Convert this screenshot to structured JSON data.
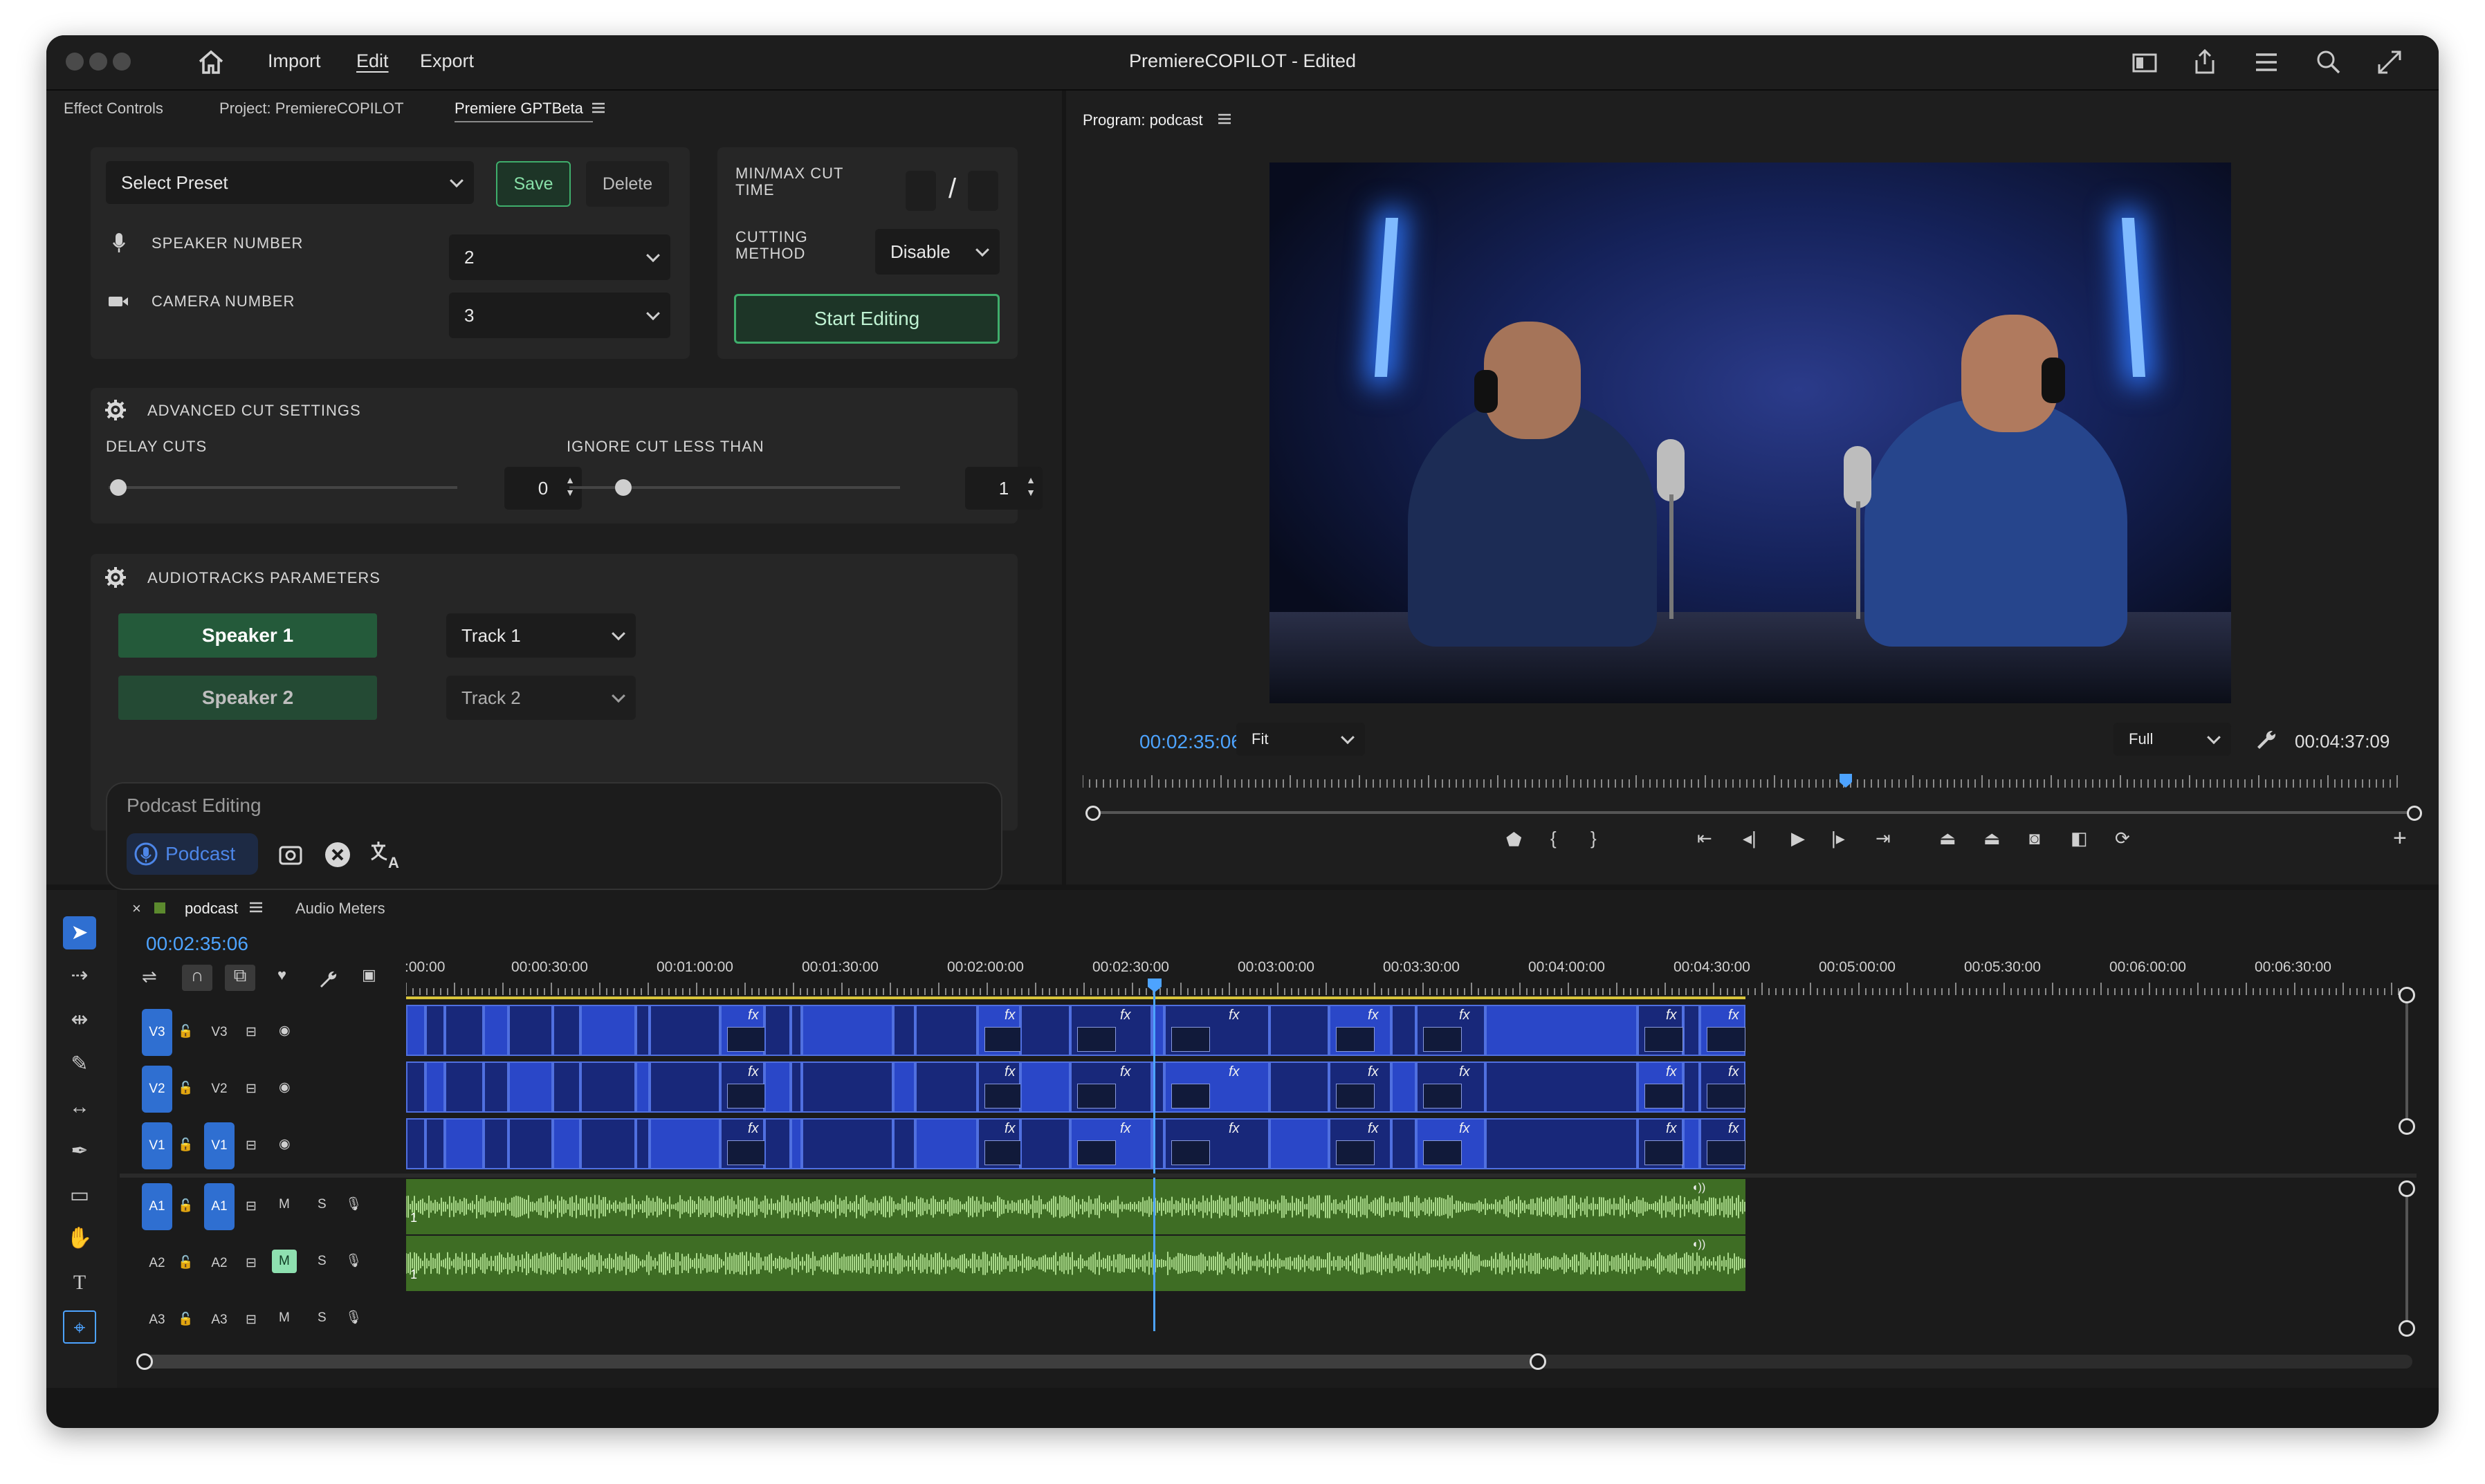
{
  "menu": {
    "items": [
      "Import",
      "Edit",
      "Export"
    ],
    "active": "Edit"
  },
  "app_title": "PremiereCOPILOT - Edited",
  "left_tabs": [
    "Effect Controls",
    "Project: PremiereCOPILOT",
    "Premiere GPTBeta"
  ],
  "preset": {
    "select_label": "Select Preset",
    "save_label": "Save",
    "delete_label": "Delete"
  },
  "speaker_number": {
    "label": "SPEAKER NUMBER",
    "value": "2"
  },
  "camera_number": {
    "label": "CAMERA NUMBER",
    "value": "3"
  },
  "minmax": {
    "label_line1": "MIN/MAX CUT",
    "label_line2": "TIME",
    "separator": "/"
  },
  "cutting_method": {
    "label_line1": "CUTTING",
    "label_line2": "METHOD",
    "value": "Disable"
  },
  "start_editing_label": "Start Editing",
  "advanced": {
    "title": "ADVANCED CUT SETTINGS",
    "delay_label": "DELAY CUTS",
    "delay_value": "0",
    "ignore_label": "IGNORE CUT LESS THAN",
    "ignore_value": "1"
  },
  "audiotracks": {
    "title": "AUDIOTRACKS PARAMETERS",
    "rows": [
      {
        "speaker": "Speaker 1",
        "track": "Track 1"
      },
      {
        "speaker": "Speaker 2",
        "track": "Track 2"
      }
    ]
  },
  "prompt": {
    "placeholder": "Podcast Editing",
    "chip": "Podcast"
  },
  "program": {
    "tab": "Program: podcast",
    "timecode": "00:02:35:06",
    "fit": "Fit",
    "quality": "Full",
    "duration": "00:04:37:09"
  },
  "timeline": {
    "tab": "podcast",
    "tab2": "Audio Meters",
    "timecode": "00:02:35:06",
    "ruler": [
      ":00:00",
      "00:00:30:00",
      "00:01:00:00",
      "00:01:30:00",
      "00:02:00:00",
      "00:02:30:00",
      "00:03:00:00",
      "00:03:30:00",
      "00:04:00:00",
      "00:04:30:00",
      "00:05:00:00",
      "00:05:30:00",
      "00:06:00:00",
      "00:06:30:00"
    ],
    "tracks": [
      {
        "src": "V3",
        "name": "V3"
      },
      {
        "src": "V2",
        "name": "V2"
      },
      {
        "src": "V1",
        "name": "V1"
      },
      {
        "src": "A1",
        "name": "A1",
        "m": "M",
        "s": "S"
      },
      {
        "src": "A2",
        "name": "A2",
        "m": "M",
        "s": "S"
      },
      {
        "src": "A3",
        "name": "A3",
        "m": "M",
        "s": "S"
      }
    ],
    "fx": "fx",
    "clip_label": "1"
  },
  "colors": {
    "accent_blue": "#4da3ff",
    "green_button": "#245a3a",
    "clip_blue": "#1f38a8",
    "audio_green": "#3e6d24",
    "waveform": "#a9d98a"
  },
  "icons": [
    "home-icon",
    "microphone-icon",
    "camera-icon",
    "gear-icon",
    "selection-tool-icon",
    "razor-icon",
    "hand-icon",
    "type-icon",
    "pen-icon",
    "play-icon",
    "wrench-icon"
  ]
}
